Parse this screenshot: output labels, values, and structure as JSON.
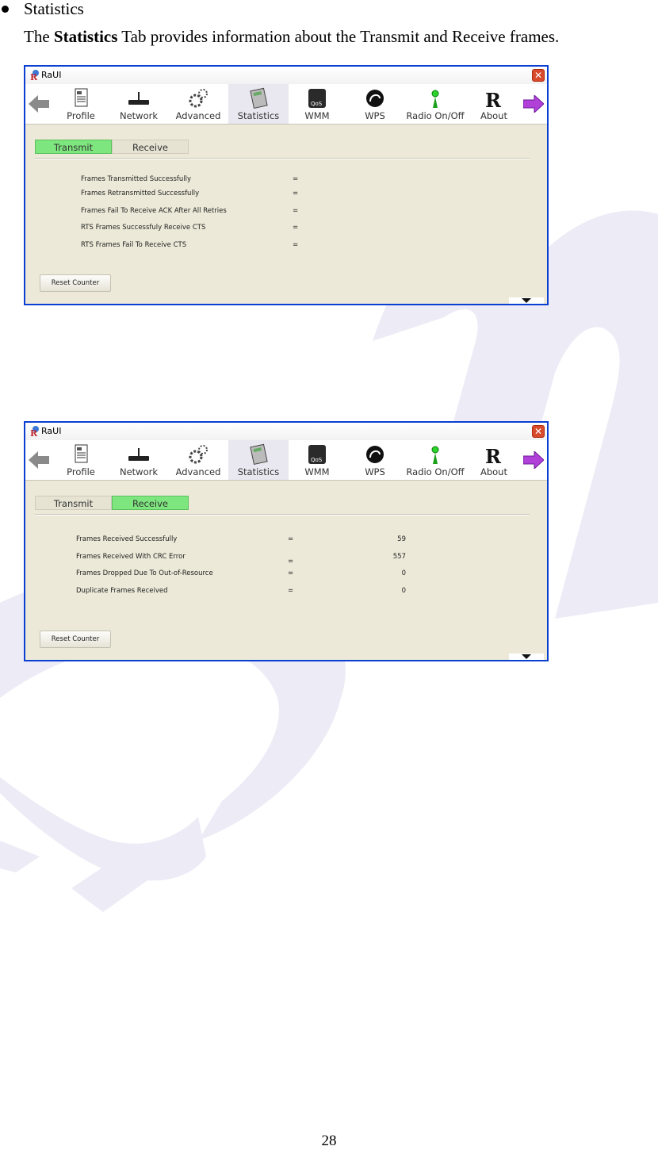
{
  "doc": {
    "bullet_heading": "Statistics",
    "intro_prefix": "The ",
    "intro_bold": "Statistics",
    "intro_rest": " Tab provides information about the Transmit and Receive frames.",
    "page_number": "28"
  },
  "window_title": "RaUI",
  "toolbar": {
    "items": [
      {
        "label": "Profile",
        "icon": "profile-icon"
      },
      {
        "label": "Network",
        "icon": "network-icon"
      },
      {
        "label": "Advanced",
        "icon": "advanced-icon"
      },
      {
        "label": "Statistics",
        "icon": "statistics-icon",
        "active": true
      },
      {
        "label": "WMM",
        "icon": "wmm-icon"
      },
      {
        "label": "WPS",
        "icon": "wps-icon"
      },
      {
        "label": "Radio On/Off",
        "icon": "radio-icon"
      },
      {
        "label": "About",
        "icon": "about-icon"
      }
    ],
    "wmm_badge": "QoS"
  },
  "tabs": {
    "transmit": "Transmit",
    "receive": "Receive"
  },
  "transmit_panel": {
    "rows": [
      {
        "label": "Frames Transmitted Successfully",
        "eq": "="
      },
      {
        "label": "Frames Retransmitted Successfully",
        "eq": "="
      },
      {
        "label": "Frames Fail To Receive ACK After All Retries",
        "eq": "="
      },
      {
        "label": "RTS Frames Successfuly Receive CTS",
        "eq": "="
      },
      {
        "label": "RTS Frames Fail To Receive CTS",
        "eq": "="
      }
    ],
    "reset_label": "Reset Counter"
  },
  "receive_panel": {
    "rows": [
      {
        "label": "Frames Received Successfully",
        "eq": "=",
        "value": "59"
      },
      {
        "label": "Frames Received With CRC Error",
        "eq": "=",
        "value": "557"
      },
      {
        "label": "Frames Dropped Due To Out-of-Resource",
        "eq": "=",
        "value": "0"
      },
      {
        "label": "Duplicate Frames Received",
        "eq": "=",
        "value": "0"
      }
    ],
    "reset_label": "Reset Counter"
  },
  "colors": {
    "window_border": "#0a3fd1",
    "active_tab": "#7ee67e",
    "close_button": "#d84a2c"
  }
}
